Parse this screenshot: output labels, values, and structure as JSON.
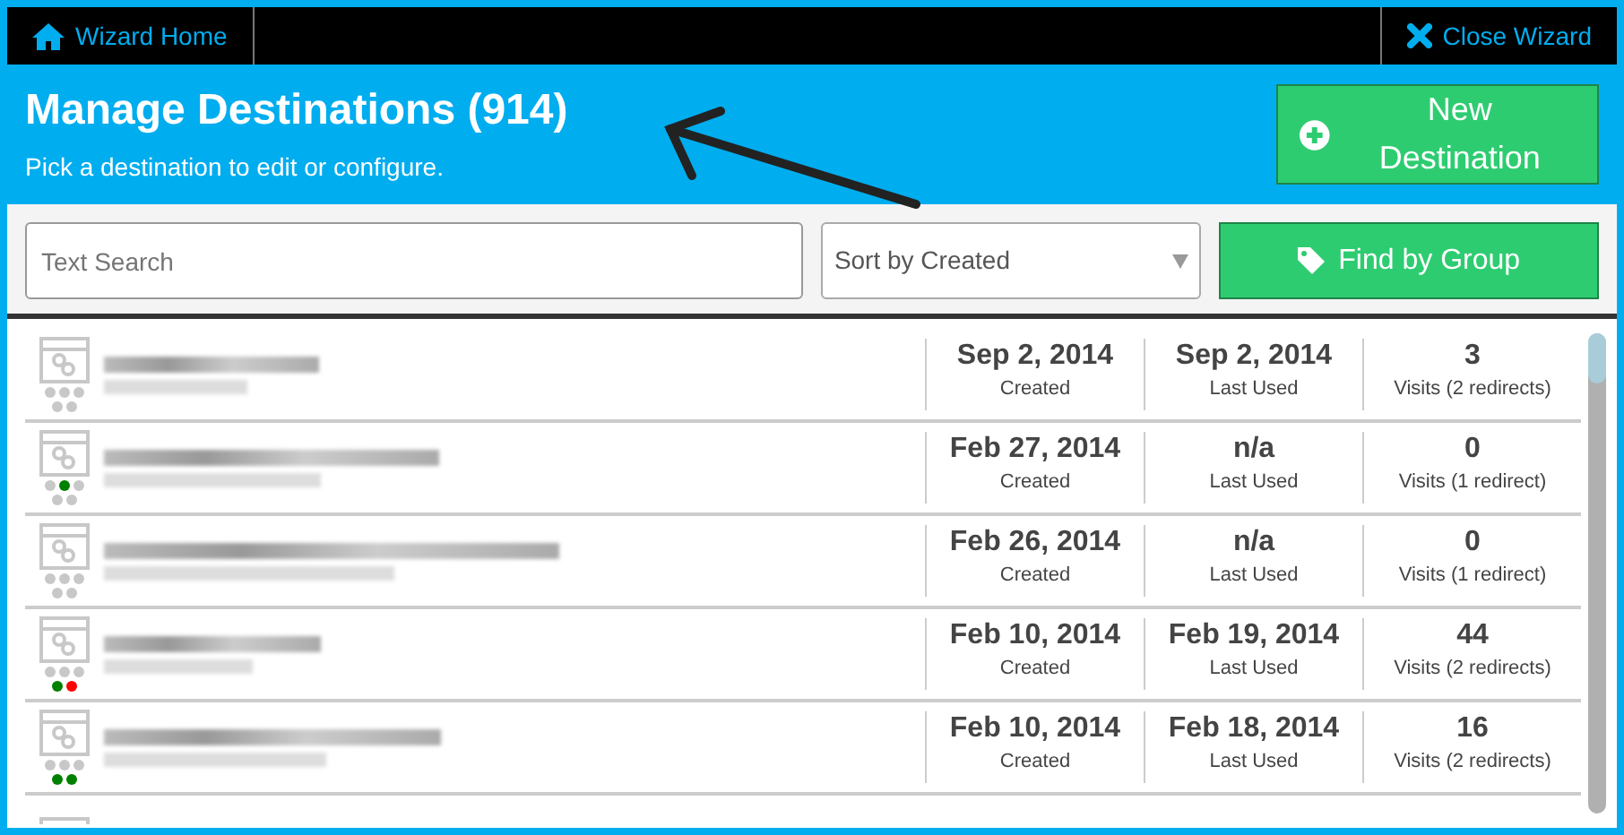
{
  "top_bar": {
    "home_link": "Wizard Home",
    "close_link": "Close Wizard"
  },
  "header": {
    "title": "Manage Destinations (914)",
    "subtitle": "Pick a destination to edit or configure.",
    "new_button": "New Destination"
  },
  "toolbar": {
    "search": {
      "placeholder": "Text Search"
    },
    "sort": {
      "value": "Sort by Created"
    },
    "group_button": "Find by Group"
  },
  "destinations": [
    {
      "status_dots": [
        {
          "color": "#c8c8c8"
        },
        {
          "color": "#c8c8c8"
        },
        {
          "color": "#c8c8c8"
        },
        {
          "color": "#c8c8c8"
        },
        {
          "color": "#c8c8c8"
        }
      ],
      "created": "Sep 2, 2014",
      "created_label": "Created",
      "last_used": "Sep 2, 2014",
      "last_used_label": "Last Used",
      "visits": "3",
      "visits_label": "Visits (2 redirects)"
    },
    {
      "status_dots": [
        {
          "color": "#c8c8c8"
        },
        {
          "color": "#008000"
        },
        {
          "color": "#c8c8c8"
        },
        {
          "color": "#c8c8c8"
        },
        {
          "color": "#c8c8c8"
        }
      ],
      "created": "Feb 27, 2014",
      "created_label": "Created",
      "last_used": "n/a",
      "last_used_label": "Last Used",
      "visits": "0",
      "visits_label": "Visits (1 redirect)"
    },
    {
      "status_dots": [
        {
          "color": "#c8c8c8"
        },
        {
          "color": "#c8c8c8"
        },
        {
          "color": "#c8c8c8"
        },
        {
          "color": "#c8c8c8"
        },
        {
          "color": "#c8c8c8"
        }
      ],
      "created": "Feb 26, 2014",
      "created_label": "Created",
      "last_used": "n/a",
      "last_used_label": "Last Used",
      "visits": "0",
      "visits_label": "Visits (1 redirect)"
    },
    {
      "status_dots": [
        {
          "color": "#c8c8c8"
        },
        {
          "color": "#c8c8c8"
        },
        {
          "color": "#c8c8c8"
        },
        {
          "color": "#008000"
        },
        {
          "color": "#ff0000"
        }
      ],
      "created": "Feb 10, 2014",
      "created_label": "Created",
      "last_used": "Feb 19, 2014",
      "last_used_label": "Last Used",
      "visits": "44",
      "visits_label": "Visits (2 redirects)"
    },
    {
      "status_dots": [
        {
          "color": "#c8c8c8"
        },
        {
          "color": "#c8c8c8"
        },
        {
          "color": "#c8c8c8"
        },
        {
          "color": "#008000"
        },
        {
          "color": "#008000"
        }
      ],
      "created": "Feb 10, 2014",
      "created_label": "Created",
      "last_used": "Feb 18, 2014",
      "last_used_label": "Last Used",
      "visits": "16",
      "visits_label": "Visits (2 redirects)"
    }
  ]
}
